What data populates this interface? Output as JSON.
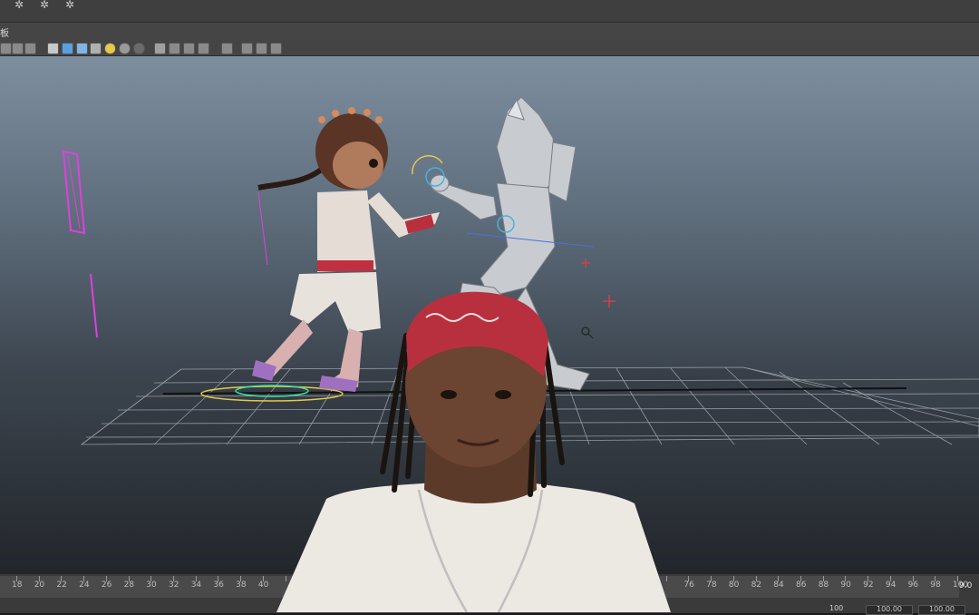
{
  "menubar": {
    "label": "板"
  },
  "topbar": {
    "stars": [
      "✲",
      "✲",
      "✲"
    ]
  },
  "timeline": {
    "ticks": [
      "18",
      "20",
      "22",
      "24",
      "26",
      "28",
      "30",
      "32",
      "34",
      "36",
      "38",
      "40",
      "",
      "",
      "",
      "",
      "",
      "",
      "",
      "",
      "",
      "",
      "",
      "",
      "",
      "",
      "",
      "",
      "",
      "",
      "76",
      "78",
      "80",
      "82",
      "84",
      "86",
      "88",
      "90",
      "92",
      "94",
      "96",
      "98",
      "100"
    ],
    "end_frame": "9.0",
    "range_values": [
      "100",
      "100.00",
      "100.00"
    ]
  },
  "colors": {
    "viewport_top": "#7d8e9f",
    "viewport_bottom": "#22262b",
    "rig_magenta": "#e040e0",
    "grid_line": "#b8c0c8"
  }
}
